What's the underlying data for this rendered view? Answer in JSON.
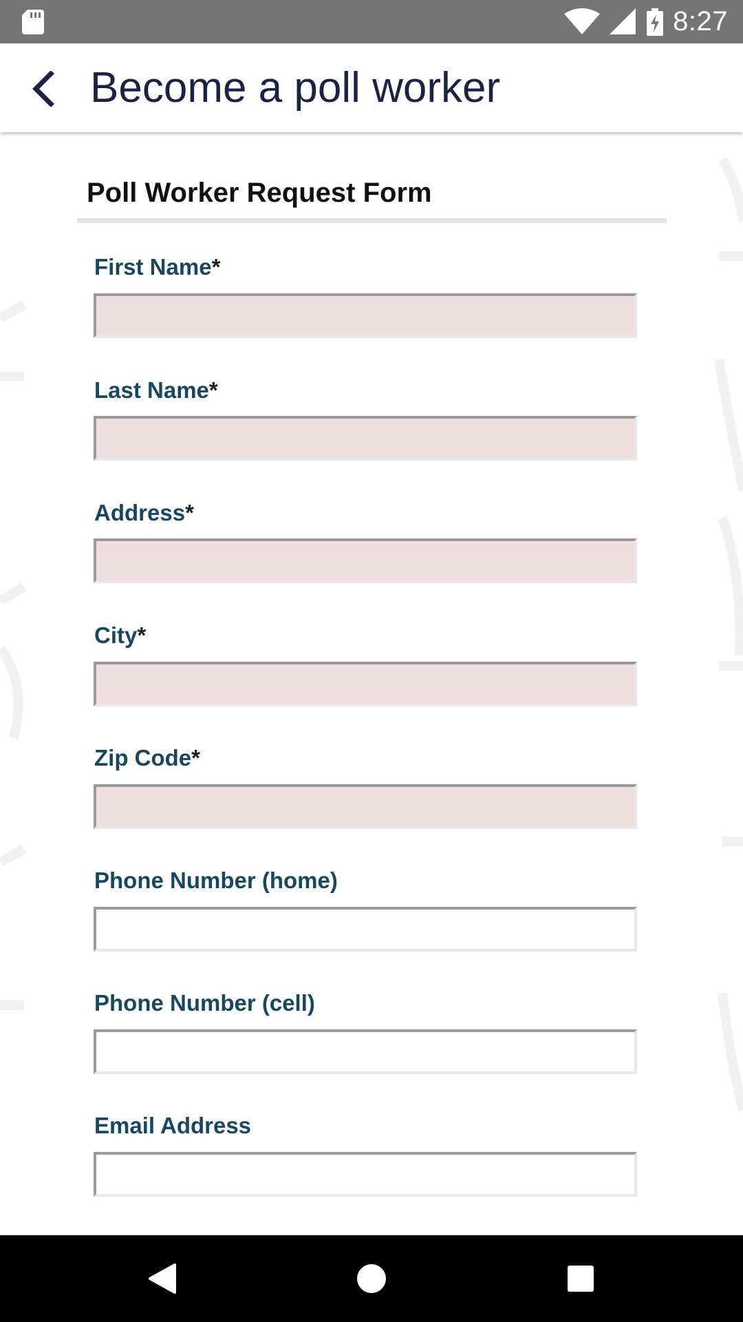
{
  "status_bar": {
    "time": "8:27",
    "icons": [
      "sd-card-icon",
      "wifi-icon",
      "cell-signal-icon",
      "battery-charging-icon"
    ]
  },
  "app_bar": {
    "title": "Become a poll worker",
    "back_icon": "chevron-left-icon"
  },
  "form": {
    "title": "Poll Worker Request Form",
    "required_marker": "*",
    "fields": [
      {
        "label": "First Name",
        "required": true,
        "value": "",
        "placeholder": ""
      },
      {
        "label": "Last Name",
        "required": true,
        "value": "",
        "placeholder": ""
      },
      {
        "label": "Address",
        "required": true,
        "value": "",
        "placeholder": ""
      },
      {
        "label": "City",
        "required": true,
        "value": "",
        "placeholder": ""
      },
      {
        "label": "Zip Code",
        "required": true,
        "value": "",
        "placeholder": ""
      },
      {
        "label": "Phone Number (home)",
        "required": false,
        "value": "",
        "placeholder": ""
      },
      {
        "label": "Phone Number (cell)",
        "required": false,
        "value": "",
        "placeholder": ""
      },
      {
        "label": "Email Address",
        "required": false,
        "value": "",
        "placeholder": ""
      }
    ]
  },
  "nav_bar": {
    "icons": [
      "back-triangle-icon",
      "home-circle-icon",
      "recents-square-icon"
    ]
  },
  "colors": {
    "status_bar": "#757575",
    "title_text": "#1b2244",
    "label_text": "#17485f",
    "required_field_bg": "#f0dfdf",
    "nav_bar": "#000000"
  }
}
